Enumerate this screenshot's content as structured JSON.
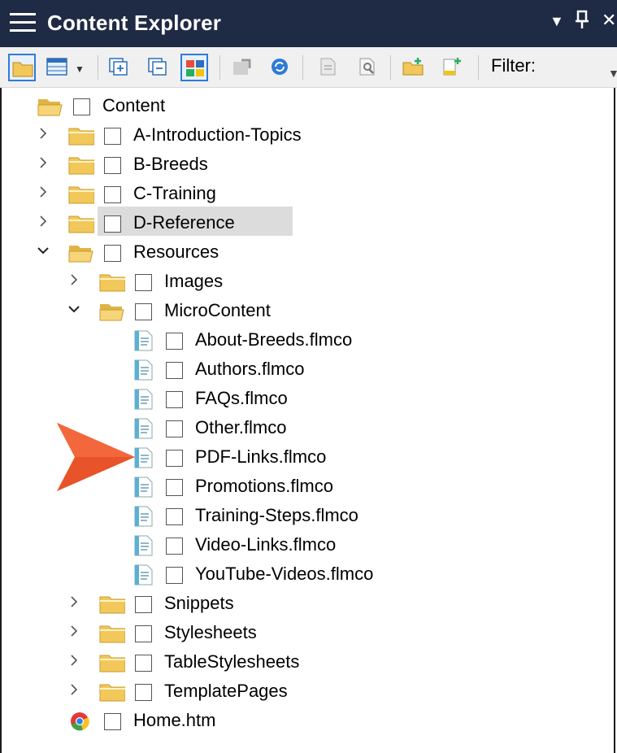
{
  "panel": {
    "title": "Content Explorer",
    "filter_label": "Filter:",
    "dropdown_glyph": "▼",
    "pin_glyph": "ᚼ",
    "close_glyph": "✕"
  },
  "colors": {
    "titlebar": "#1f2a44",
    "selection": "#dcdcdc",
    "callout_arrow": "#e8532a",
    "folder": "#f2c85b"
  },
  "tree": {
    "root": {
      "label": "Content",
      "icon": "folder-open-icon"
    },
    "items": [
      {
        "label": "A-Introduction-Topics",
        "icon": "folder-icon",
        "expander": "collapsed"
      },
      {
        "label": "B-Breeds",
        "icon": "folder-icon",
        "expander": "collapsed"
      },
      {
        "label": "C-Training",
        "icon": "folder-icon",
        "expander": "collapsed"
      },
      {
        "label": "D-Reference",
        "icon": "folder-icon",
        "expander": "collapsed"
      },
      {
        "label": "Resources",
        "icon": "folder-open-icon",
        "expander": "expanded"
      },
      {
        "label": "Images",
        "icon": "folder-icon",
        "expander": "collapsed"
      },
      {
        "label": "MicroContent",
        "icon": "folder-open-icon",
        "expander": "expanded",
        "selected": true
      },
      {
        "label": "About-Breeds.flmco",
        "icon": "micro-content-file-icon"
      },
      {
        "label": "Authors.flmco",
        "icon": "micro-content-file-icon"
      },
      {
        "label": "FAQs.flmco",
        "icon": "micro-content-file-icon"
      },
      {
        "label": "Other.flmco",
        "icon": "micro-content-file-icon"
      },
      {
        "label": "PDF-Links.flmco",
        "icon": "micro-content-file-icon"
      },
      {
        "label": "Promotions.flmco",
        "icon": "micro-content-file-icon"
      },
      {
        "label": "Training-Steps.flmco",
        "icon": "micro-content-file-icon"
      },
      {
        "label": "Video-Links.flmco",
        "icon": "micro-content-file-icon"
      },
      {
        "label": "YouTube-Videos.flmco",
        "icon": "micro-content-file-icon"
      },
      {
        "label": "Snippets",
        "icon": "folder-icon",
        "expander": "collapsed"
      },
      {
        "label": "Stylesheets",
        "icon": "folder-icon",
        "expander": "collapsed"
      },
      {
        "label": "TableStylesheets",
        "icon": "folder-icon",
        "expander": "collapsed"
      },
      {
        "label": "TemplatePages",
        "icon": "folder-icon",
        "expander": "collapsed"
      },
      {
        "label": "Home.htm",
        "icon": "chrome-browser-icon"
      }
    ]
  }
}
